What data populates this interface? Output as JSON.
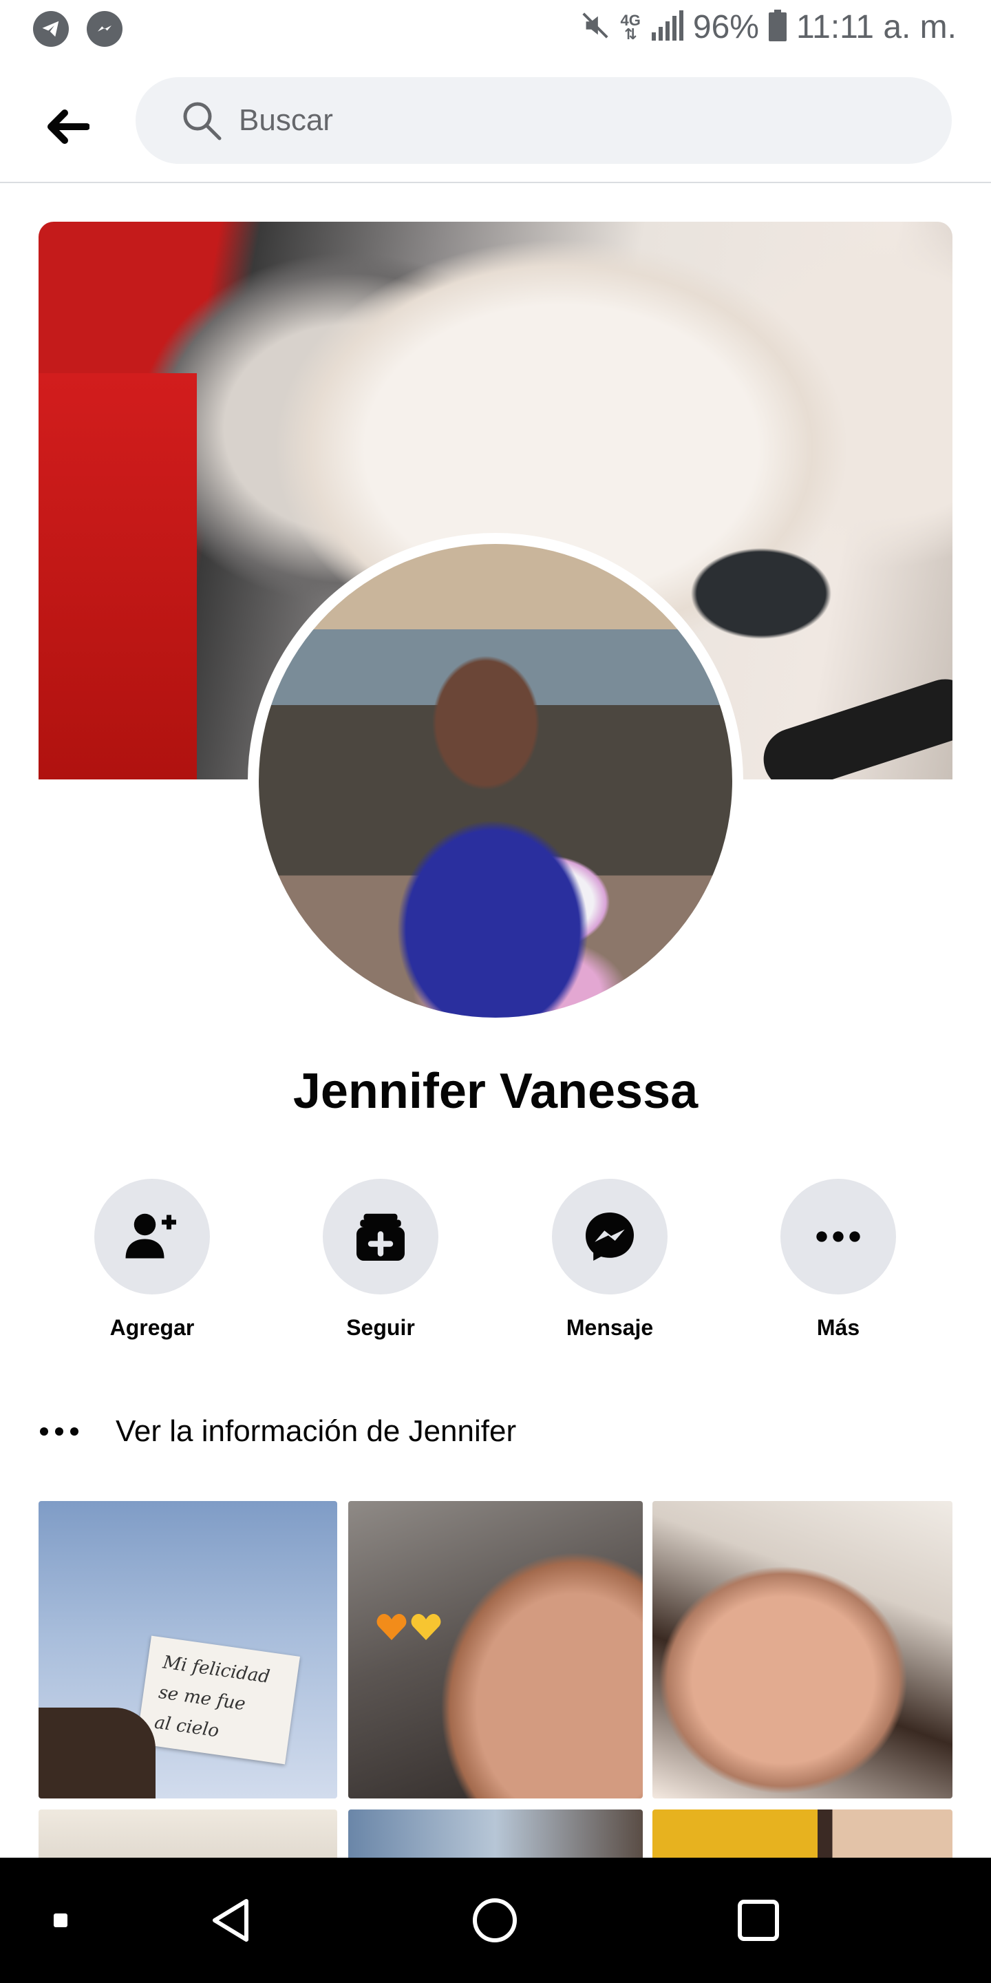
{
  "status_bar": {
    "network": "4G",
    "battery": "96%",
    "time": "11:11 a. m."
  },
  "search": {
    "placeholder": "Buscar"
  },
  "profile": {
    "name": "Jennifer Vanessa"
  },
  "actions": [
    {
      "label": "Agregar",
      "icon": "add-friend-icon"
    },
    {
      "label": "Seguir",
      "icon": "follow-icon"
    },
    {
      "label": "Mensaje",
      "icon": "messenger-icon"
    },
    {
      "label": "Más",
      "icon": "more-icon"
    }
  ],
  "info": {
    "label": "Ver la información de Jennifer"
  },
  "photos": {
    "note_text": [
      "Mi felicidad",
      "se me fue",
      "al cielo"
    ]
  },
  "colors": {
    "button_bg": "#e4e6eb",
    "search_bg": "#f0f2f5",
    "text": "#050505",
    "secondary_text": "#65676b"
  }
}
